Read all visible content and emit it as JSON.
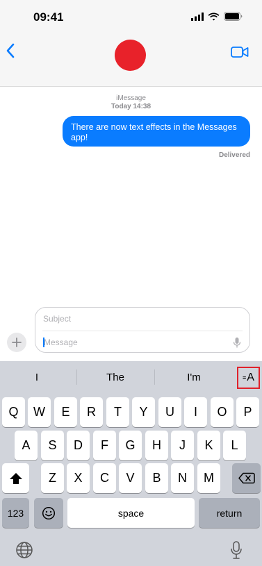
{
  "status_bar": {
    "time": "09:41",
    "icons": [
      "cellular-signal-icon",
      "wifi-icon",
      "battery-icon"
    ]
  },
  "header": {
    "back_icon": "chevron-left-icon",
    "video_icon": "video-camera-icon",
    "avatar_color": "#e8222a"
  },
  "conversation": {
    "service": "iMessage",
    "timestamp": "Today 14:38",
    "messages": [
      {
        "text": "There are now text effects in the Messages app!",
        "status": "Delivered"
      }
    ]
  },
  "composer": {
    "subject_placeholder": "Subject",
    "message_placeholder": "Message",
    "message_value": ""
  },
  "keyboard": {
    "predictions": [
      "I",
      "The",
      "I'm"
    ],
    "text_effects_label": "A",
    "rows": [
      [
        "Q",
        "W",
        "E",
        "R",
        "T",
        "Y",
        "U",
        "I",
        "O",
        "P"
      ],
      [
        "A",
        "S",
        "D",
        "F",
        "G",
        "H",
        "J",
        "K",
        "L"
      ],
      [
        "Z",
        "X",
        "C",
        "V",
        "B",
        "N",
        "M"
      ]
    ],
    "numbers_label": "123",
    "space_label": "space",
    "return_label": "return"
  },
  "colors": {
    "bubble": "#0a7cff",
    "accent": "#0a7cff",
    "highlight": "#e0222b"
  }
}
